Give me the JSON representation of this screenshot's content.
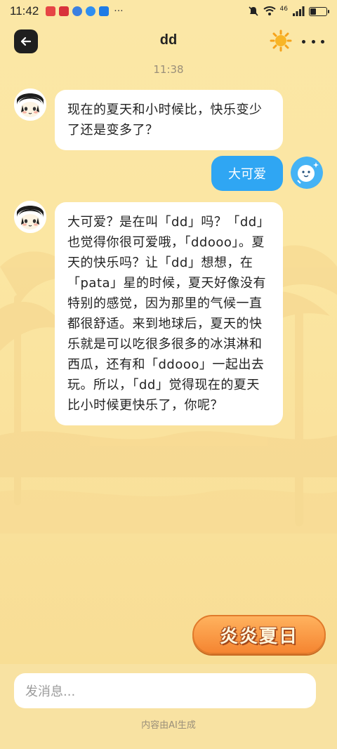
{
  "status_bar": {
    "time": "11:42",
    "network": "46",
    "battery_level": 0.35
  },
  "header": {
    "title": "dd",
    "back_icon": "arrow-left-icon",
    "theme_icon": "sun-icon",
    "more_icon": "more-dots-icon"
  },
  "timestamp": "11:38",
  "messages": [
    {
      "from": "bot",
      "text": "现在的夏天和小时候比，快乐变少了还是变多了？"
    },
    {
      "from": "user",
      "text": "大可爱"
    },
    {
      "from": "bot",
      "text": "大可爱？是在叫「dd」吗？「dd」也觉得你很可爱哦，「ddooo」。夏天的快乐吗？让「dd」想想，在「pata」星的时候，夏天好像没有特别的感觉，因为那里的气候一直都很舒适。来到地球后，夏天的快乐就是可以吃很多很多的冰淇淋和西瓜，还有和「ddooo」一起出去玩。所以，「dd」觉得现在的夏天比小时候更快乐了，你呢？"
    }
  ],
  "badge": {
    "label": "炎炎夏日"
  },
  "composer": {
    "placeholder": "发消息..."
  },
  "ai_note": "内容由AI生成",
  "colors": {
    "background": "#fbe7a6",
    "user_bubble": "#2fa6f3",
    "bot_bubble": "#ffffff",
    "badge": "#f58531"
  }
}
